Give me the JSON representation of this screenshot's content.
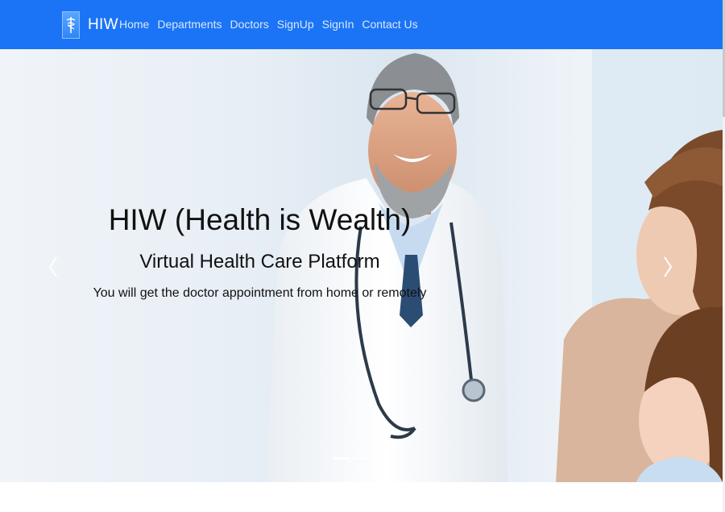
{
  "brand": {
    "name": "HIW",
    "logo_icon": "caduceus-icon"
  },
  "nav": {
    "items": [
      "Home",
      "Departments",
      "Doctors",
      "SignUp",
      "SignIn",
      "Contact Us"
    ]
  },
  "hero": {
    "title": "HIW (Health is Wealth)",
    "subtitle": "Virtual Health Care Platform",
    "tagline": "You will get the doctor appointment from home or remotely",
    "prev_icon": "chevron-left-icon",
    "next_icon": "chevron-right-icon",
    "slides_total": 3,
    "active_slide": 1
  },
  "colors": {
    "navbar": "#1b74f5",
    "nav_text": "#d9e8ff",
    "brand_text": "#ffffff"
  }
}
